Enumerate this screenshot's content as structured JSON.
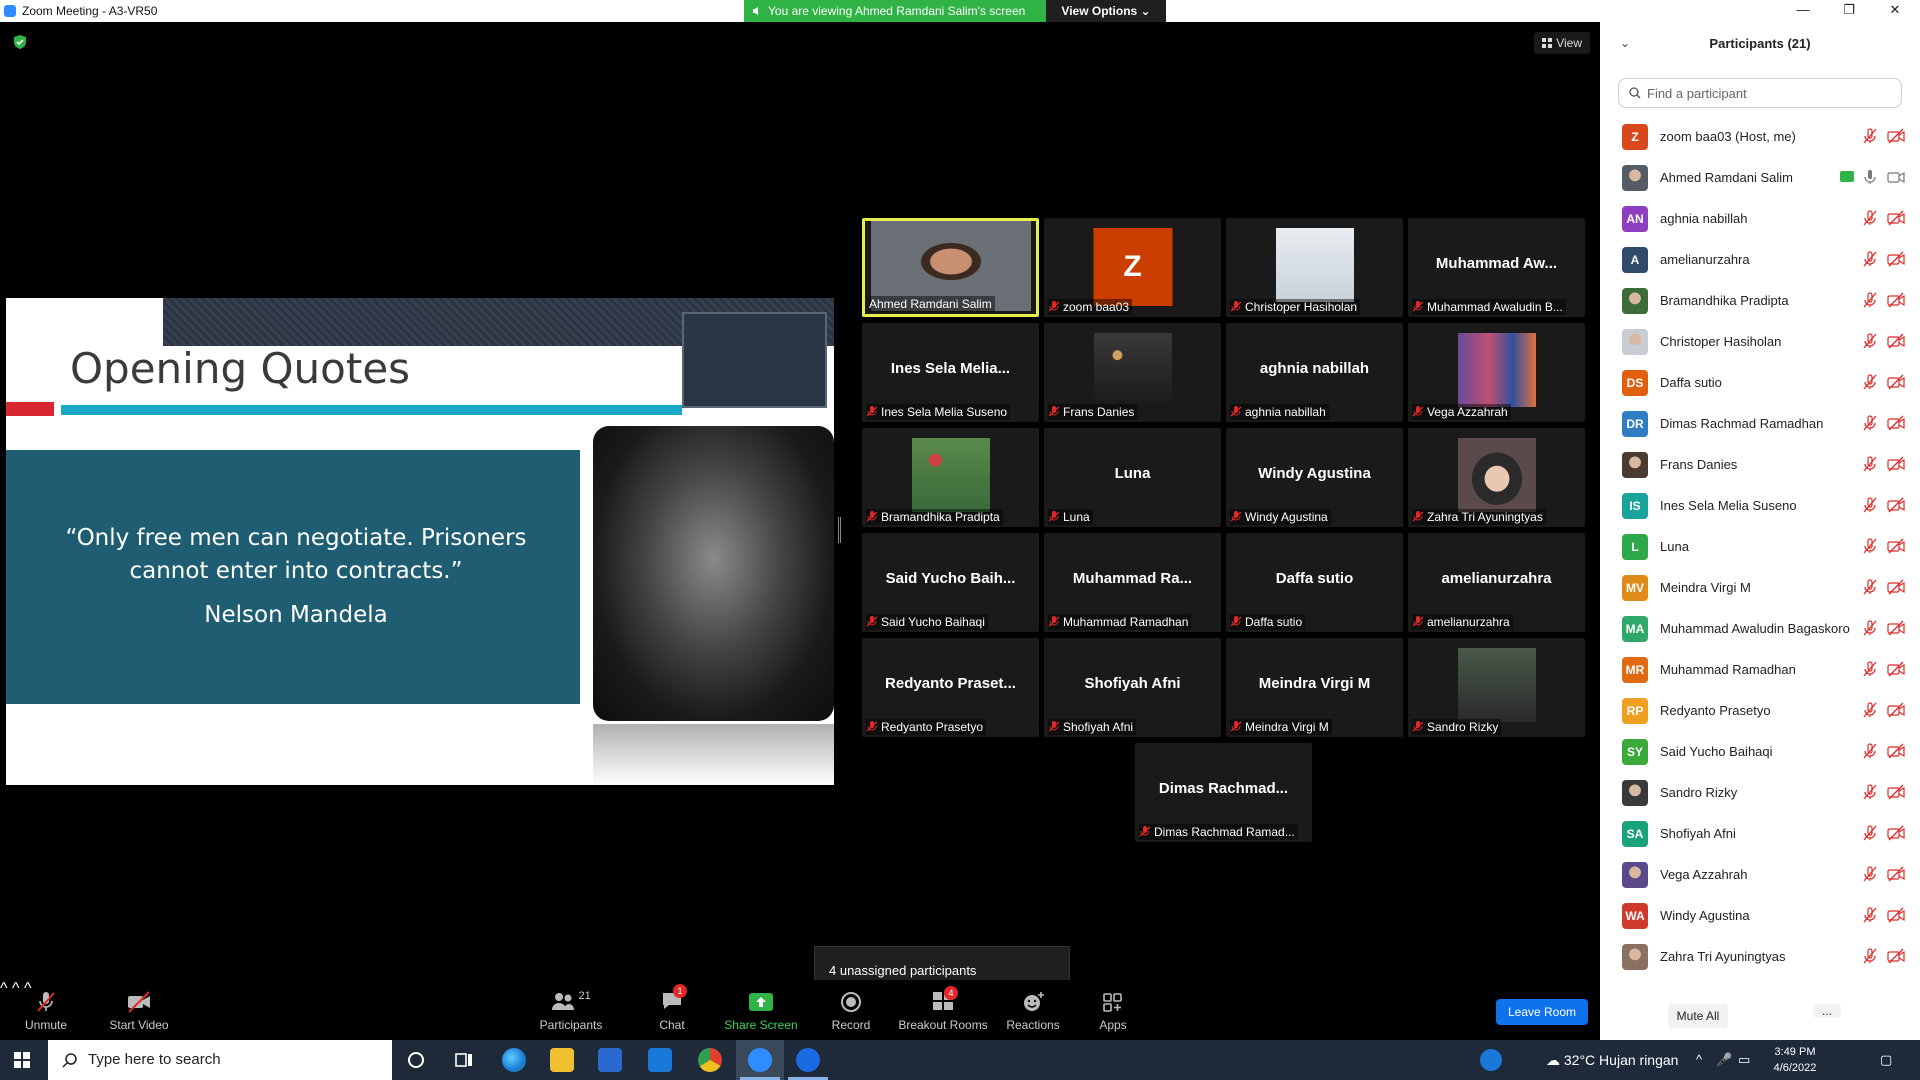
{
  "window": {
    "title": "Zoom Meeting - A3-VR50",
    "controls": [
      "—",
      "❐",
      "✕"
    ]
  },
  "share_banner": {
    "message": "You are viewing Ahmed Ramdani Salim's screen",
    "options_label": "View Options ⌄"
  },
  "view_button": "View",
  "slide": {
    "title": "Opening Quotes",
    "quote": "“Only free men can negotiate. Prisoners cannot enter into contracts.”",
    "author": "Nelson Mandela"
  },
  "gallery": [
    {
      "display": "",
      "label": "Ahmed Ramdani Salim",
      "muted": false,
      "photo": "ahmed"
    },
    {
      "display": "Z",
      "label": "zoom baa03",
      "muted": true,
      "photo": "z"
    },
    {
      "display": "",
      "label": "Christoper Hasiholan",
      "muted": true,
      "photo": "christoper"
    },
    {
      "display": "Muhammad Aw...",
      "label": "Muhammad Awaludin B...",
      "muted": true,
      "photo": ""
    },
    {
      "display": "Ines Sela Melia...",
      "label": "Ines Sela Melia Suseno",
      "muted": true,
      "photo": ""
    },
    {
      "display": "",
      "label": "Frans Danies",
      "muted": true,
      "photo": "frans"
    },
    {
      "display": "aghnia nabillah",
      "label": "aghnia nabillah",
      "muted": true,
      "photo": ""
    },
    {
      "display": "",
      "label": "Vega Azzahrah",
      "muted": true,
      "photo": "vega"
    },
    {
      "display": "",
      "label": "Bramandhika Pradipta",
      "muted": true,
      "photo": "bram"
    },
    {
      "display": "Luna",
      "label": "Luna",
      "muted": true,
      "photo": ""
    },
    {
      "display": "Windy Agustina",
      "label": "Windy Agustina",
      "muted": true,
      "photo": ""
    },
    {
      "display": "",
      "label": "Zahra Tri Ayuningtyas",
      "muted": true,
      "photo": "zahra"
    },
    {
      "display": "Said Yucho Baih...",
      "label": "Said Yucho Baihaqi",
      "muted": true,
      "photo": ""
    },
    {
      "display": "Muhammad Ra...",
      "label": "Muhammad Ramadhan",
      "muted": true,
      "photo": ""
    },
    {
      "display": "Daffa sutio",
      "label": "Daffa sutio",
      "muted": true,
      "photo": ""
    },
    {
      "display": "amelianurzahra",
      "label": "amelianurzahra",
      "muted": true,
      "photo": ""
    },
    {
      "display": "Redyanto Praset...",
      "label": "Redyanto Prasetyo",
      "muted": true,
      "photo": ""
    },
    {
      "display": "Shofiyah Afni",
      "label": "Shofiyah Afni",
      "muted": true,
      "photo": ""
    },
    {
      "display": "Meindra Virgi M",
      "label": "Meindra Virgi M",
      "muted": true,
      "photo": ""
    },
    {
      "display": "",
      "label": "Sandro Rizky",
      "muted": true,
      "photo": "sandro"
    },
    {
      "display": "Dimas Rachmad...",
      "label": "Dimas Rachmad Ramad...",
      "muted": true,
      "photo": ""
    }
  ],
  "tooltip": "4 unassigned participants",
  "toolbar": {
    "unmute": "Unmute",
    "start_video": "Start Video",
    "participants": "Participants",
    "participants_count": "21",
    "chat": "Chat",
    "chat_badge": "1",
    "share_screen": "Share Screen",
    "record": "Record",
    "breakout_rooms": "Breakout Rooms",
    "breakout_badge": "4",
    "reactions": "Reactions",
    "apps": "Apps",
    "leave_room": "Leave Room"
  },
  "panel": {
    "title": "Participants (21)",
    "search_placeholder": "Find a participant",
    "mute_all": "Mute All",
    "more": "...",
    "participants": [
      {
        "initials": "Z",
        "name": "zoom baa03 (Host, me)",
        "color": "#d9481c",
        "photo": false
      },
      {
        "initials": "",
        "name": "Ahmed Ramdani Salim",
        "color": "#555c66",
        "photo": true,
        "sharing": true
      },
      {
        "initials": "AN",
        "name": "aghnia nabillah",
        "color": "#8e3fc0",
        "photo": false
      },
      {
        "initials": "A",
        "name": "amelianurzahra",
        "color": "#2f4a6b",
        "photo": false
      },
      {
        "initials": "",
        "name": "Bramandhika Pradipta",
        "color": "#3e6b3a",
        "photo": true
      },
      {
        "initials": "",
        "name": "Christoper Hasiholan",
        "color": "#c7cdd2",
        "photo": true
      },
      {
        "initials": "DS",
        "name": "Daffa sutio",
        "color": "#e06010",
        "photo": false
      },
      {
        "initials": "DR",
        "name": "Dimas Rachmad Ramadhan",
        "color": "#2f7ec2",
        "photo": false
      },
      {
        "initials": "",
        "name": "Frans Danies",
        "color": "#4a3a30",
        "photo": true
      },
      {
        "initials": "IS",
        "name": "Ines Sela Melia Suseno",
        "color": "#1aa39a",
        "photo": false
      },
      {
        "initials": "L",
        "name": "Luna",
        "color": "#2fa84a",
        "photo": false
      },
      {
        "initials": "MV",
        "name": "Meindra Virgi M",
        "color": "#e08a1a",
        "photo": false
      },
      {
        "initials": "MA",
        "name": "Muhammad Awaludin Bagaskoro",
        "color": "#2fa86a",
        "photo": false
      },
      {
        "initials": "MR",
        "name": "Muhammad Ramadhan",
        "color": "#e06a10",
        "photo": false
      },
      {
        "initials": "RP",
        "name": "Redyanto Prasetyo",
        "color": "#f0a020",
        "photo": false
      },
      {
        "initials": "SY",
        "name": "Said Yucho Baihaqi",
        "color": "#3aaa3a",
        "photo": false
      },
      {
        "initials": "",
        "name": "Sandro Rizky",
        "color": "#3a3a3a",
        "photo": true
      },
      {
        "initials": "SA",
        "name": "Shofiyah Afni",
        "color": "#1aa37a",
        "photo": false
      },
      {
        "initials": "",
        "name": "Vega Azzahrah",
        "color": "#5a4a8a",
        "photo": true
      },
      {
        "initials": "WA",
        "name": "Windy Agustina",
        "color": "#d03a2a",
        "photo": false
      },
      {
        "initials": "",
        "name": "Zahra Tri Ayuningtyas",
        "color": "#8a7060",
        "photo": true
      }
    ]
  },
  "taskbar": {
    "search_placeholder": "Type here to search",
    "weather": "32°C  Hujan ringan",
    "time": "3:49 PM",
    "date": "4/6/2022"
  }
}
